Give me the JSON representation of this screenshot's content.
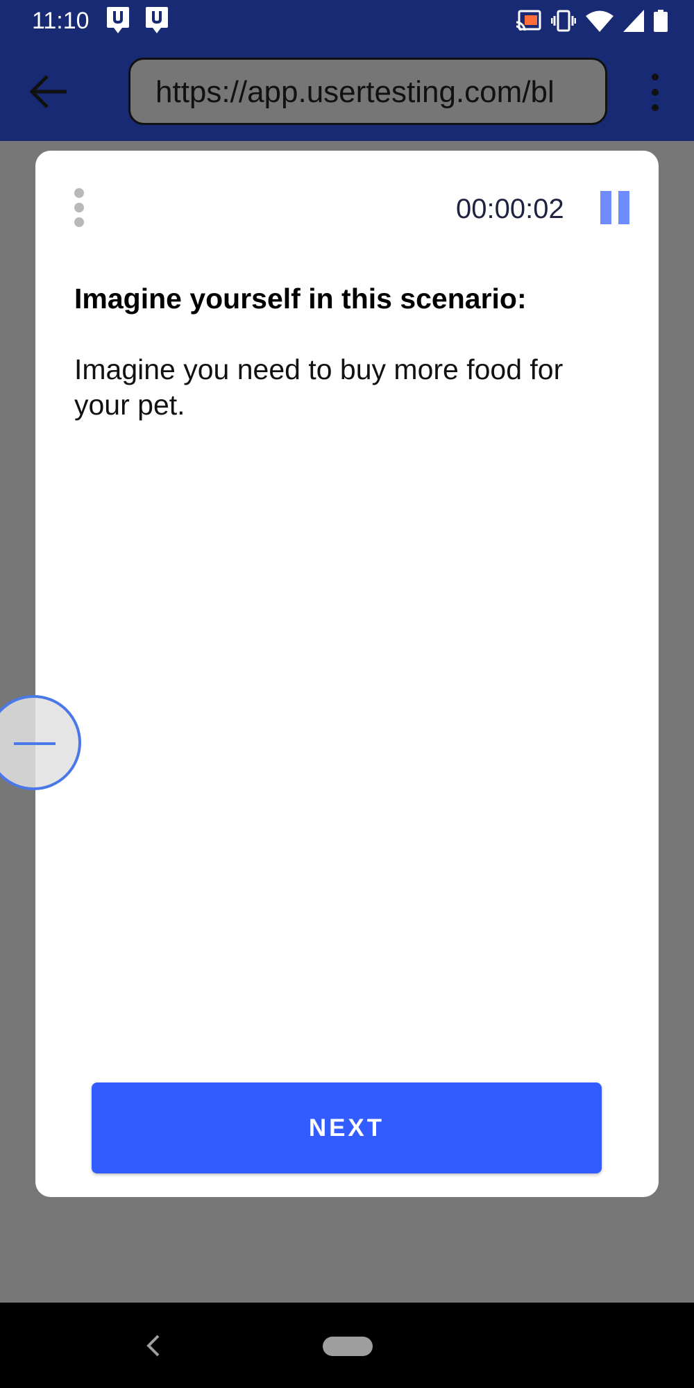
{
  "status_bar": {
    "time": "11:10",
    "notification_icons": [
      "usertesting-notification-icon",
      "usertesting-notification-icon"
    ],
    "right_icons": [
      "cast-icon",
      "vibrate-icon",
      "wifi-icon",
      "cell-signal-icon",
      "battery-icon"
    ],
    "cast_accent_color": "#ff6d3a"
  },
  "browser": {
    "url": "https://app.usertesting.com/bl",
    "bar_color": "#172a73"
  },
  "task_card": {
    "timer": "00:00:02",
    "heading": "Imagine yourself in this scenario:",
    "body": "Imagine you need to buy more food for your pet.",
    "next_label": "NEXT",
    "accent_color": "#335cff"
  },
  "nav_bar": {
    "icons": [
      "nav-back-icon",
      "home-pill-icon"
    ]
  }
}
